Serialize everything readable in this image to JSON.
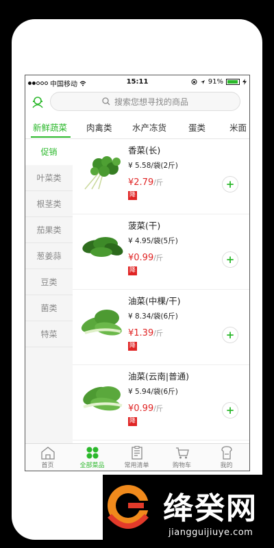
{
  "status_bar": {
    "carrier": "中国移动",
    "time": "15:11",
    "battery": "91%",
    "battery_level": 0.91
  },
  "search": {
    "placeholder": "搜索您想寻找的商品"
  },
  "category_tabs": [
    {
      "label": "新鲜蔬菜",
      "active": true
    },
    {
      "label": "肉禽类",
      "active": false
    },
    {
      "label": "水产冻货",
      "active": false
    },
    {
      "label": "蛋类",
      "active": false
    },
    {
      "label": "米面",
      "active": false
    }
  ],
  "side_menu": [
    {
      "label": "促销",
      "active": true
    },
    {
      "label": "叶菜类",
      "active": false
    },
    {
      "label": "根茎类",
      "active": false
    },
    {
      "label": "茄果类",
      "active": false
    },
    {
      "label": "葱姜蒜",
      "active": false
    },
    {
      "label": "豆类",
      "active": false
    },
    {
      "label": "菌类",
      "active": false
    },
    {
      "label": "特菜",
      "active": false
    }
  ],
  "products": [
    {
      "name": "香菜(长)",
      "spec": "¥ 5.58/袋(2斤)",
      "price": "¥2.79",
      "unit": "/斤",
      "badge": "降",
      "add": "+",
      "icon": "cilantro-image"
    },
    {
      "name": "菠菜(干)",
      "spec": "¥ 4.95/袋(5斤)",
      "price": "¥0.99",
      "unit": "/斤",
      "badge": "降",
      "add": "+",
      "icon": "spinach-image"
    },
    {
      "name": "油菜(中棵/干)",
      "spec": "¥ 8.34/袋(6斤)",
      "price": "¥1.39",
      "unit": "/斤",
      "badge": "降",
      "add": "+",
      "icon": "bok-choy-image"
    },
    {
      "name": "油菜(云南|普通)",
      "spec": "¥ 5.94/袋(6斤)",
      "price": "¥0.99",
      "unit": "/斤",
      "badge": "降",
      "add": "+",
      "icon": "bok-choy-image"
    }
  ],
  "bottom_nav": [
    {
      "label": "首页",
      "active": false,
      "icon": "home-icon"
    },
    {
      "label": "全部菜品",
      "active": true,
      "icon": "grid-icon"
    },
    {
      "label": "常用清单",
      "active": false,
      "icon": "clipboard-icon"
    },
    {
      "label": "购物车",
      "active": false,
      "icon": "cart-icon"
    },
    {
      "label": "我的",
      "active": false,
      "icon": "profile-icon"
    }
  ],
  "watermark": {
    "title": "绛癸网",
    "url": "jiangguijiuye.com"
  },
  "colors": {
    "accent": "#2bb82b",
    "price": "#e02424"
  }
}
